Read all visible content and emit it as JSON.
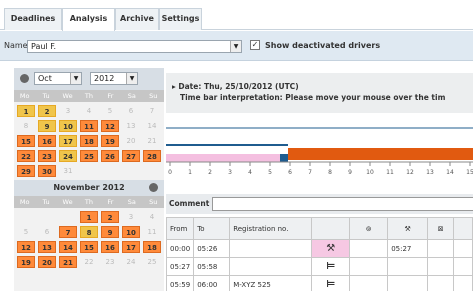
{
  "tabs": [
    {
      "label": "Deadlines"
    },
    {
      "label": "Analysis"
    },
    {
      "label": "Archive"
    },
    {
      "label": "Settings"
    }
  ],
  "namebar": {
    "label": "Name",
    "value": "Paul F.",
    "show_label": "Show deactivated drivers",
    "show_checked": "✓"
  },
  "calendar": {
    "month_value": "Oct",
    "year_value": "2012",
    "weekdays": [
      "Mo",
      "Tu",
      "We",
      "Th",
      "Fr",
      "Sa",
      "Su"
    ],
    "oct_days": [
      {
        "t": "1",
        "c": "y"
      },
      {
        "t": "2",
        "c": "y"
      },
      {
        "t": "3",
        "c": "w"
      },
      {
        "t": "4",
        "c": "w"
      },
      {
        "t": "5",
        "c": "w"
      },
      {
        "t": "6",
        "c": "w"
      },
      {
        "t": "7",
        "c": "w"
      },
      {
        "t": "8",
        "c": "w"
      },
      {
        "t": "9",
        "c": "y"
      },
      {
        "t": "10",
        "c": "y"
      },
      {
        "t": "11",
        "c": "o"
      },
      {
        "t": "12",
        "c": "o"
      },
      {
        "t": "13",
        "c": "w"
      },
      {
        "t": "14",
        "c": "w"
      },
      {
        "t": "15",
        "c": "o"
      },
      {
        "t": "16",
        "c": "o"
      },
      {
        "t": "17",
        "c": "y"
      },
      {
        "t": "18",
        "c": "o"
      },
      {
        "t": "19",
        "c": "o"
      },
      {
        "t": "20",
        "c": "w"
      },
      {
        "t": "21",
        "c": "w"
      },
      {
        "t": "22",
        "c": "o"
      },
      {
        "t": "23",
        "c": "o"
      },
      {
        "t": "24",
        "c": "y"
      },
      {
        "t": "25",
        "c": "o"
      },
      {
        "t": "26",
        "c": "o"
      },
      {
        "t": "27",
        "c": "o"
      },
      {
        "t": "28",
        "c": "o"
      },
      {
        "t": "29",
        "c": "o"
      },
      {
        "t": "30",
        "c": "o"
      },
      {
        "t": "31",
        "c": "w"
      }
    ],
    "nov_title": "November 2012",
    "nov_days": [
      {
        "t": "",
        "c": "x"
      },
      {
        "t": "",
        "c": "x"
      },
      {
        "t": "",
        "c": "x"
      },
      {
        "t": "1",
        "c": "o"
      },
      {
        "t": "2",
        "c": "o"
      },
      {
        "t": "3",
        "c": "w"
      },
      {
        "t": "4",
        "c": "w"
      },
      {
        "t": "5",
        "c": "w"
      },
      {
        "t": "6",
        "c": "w"
      },
      {
        "t": "7",
        "c": "o"
      },
      {
        "t": "8",
        "c": "y"
      },
      {
        "t": "9",
        "c": "o"
      },
      {
        "t": "10",
        "c": "o"
      },
      {
        "t": "11",
        "c": "w"
      },
      {
        "t": "12",
        "c": "o"
      },
      {
        "t": "13",
        "c": "o"
      },
      {
        "t": "14",
        "c": "o"
      },
      {
        "t": "15",
        "c": "o"
      },
      {
        "t": "16",
        "c": "o"
      },
      {
        "t": "17",
        "c": "o"
      },
      {
        "t": "18",
        "c": "o"
      },
      {
        "t": "19",
        "c": "o"
      },
      {
        "t": "20",
        "c": "o"
      },
      {
        "t": "21",
        "c": "o"
      },
      {
        "t": "22",
        "c": "w"
      },
      {
        "t": "23",
        "c": "w"
      },
      {
        "t": "24",
        "c": "w"
      },
      {
        "t": "25",
        "c": "w"
      }
    ]
  },
  "date_info": {
    "line1": "Date: Thu, 25/10/2012 (UTC)",
    "line2": "Time bar interpretation: Please move your mouse over the tim"
  },
  "timeline": {
    "ticks": [
      "0",
      "1",
      "2",
      "3",
      "4",
      "5",
      "6",
      "7",
      "8",
      "9",
      "10",
      "11",
      "12",
      "13",
      "14",
      "15"
    ]
  },
  "comment": {
    "label": "Comment"
  },
  "table": {
    "headers": [
      "From",
      "To",
      "Registration no.",
      "",
      "",
      "",
      "",
      ""
    ],
    "rows": [
      {
        "from": "00:00",
        "to": "05:26",
        "reg": "",
        "icon": "⚒",
        "c5": "",
        "c6": "05:27",
        "c7": ""
      },
      {
        "from": "05:27",
        "to": "05:58",
        "reg": "",
        "icon": "⊨",
        "c5": "",
        "c6": "",
        "c7": ""
      },
      {
        "from": "05:59",
        "to": "06:00",
        "reg": "M-XYZ 525",
        "icon": "⊨",
        "c5": "",
        "c6": "",
        "c7": ""
      }
    ]
  },
  "colors": {
    "accent": "#ff8a3a",
    "tick": "#f0c54b",
    "timeline_blue": "#1f5c8f",
    "timeline_orange": "#e15a10",
    "timeline_pink": "#f4bfe0"
  }
}
